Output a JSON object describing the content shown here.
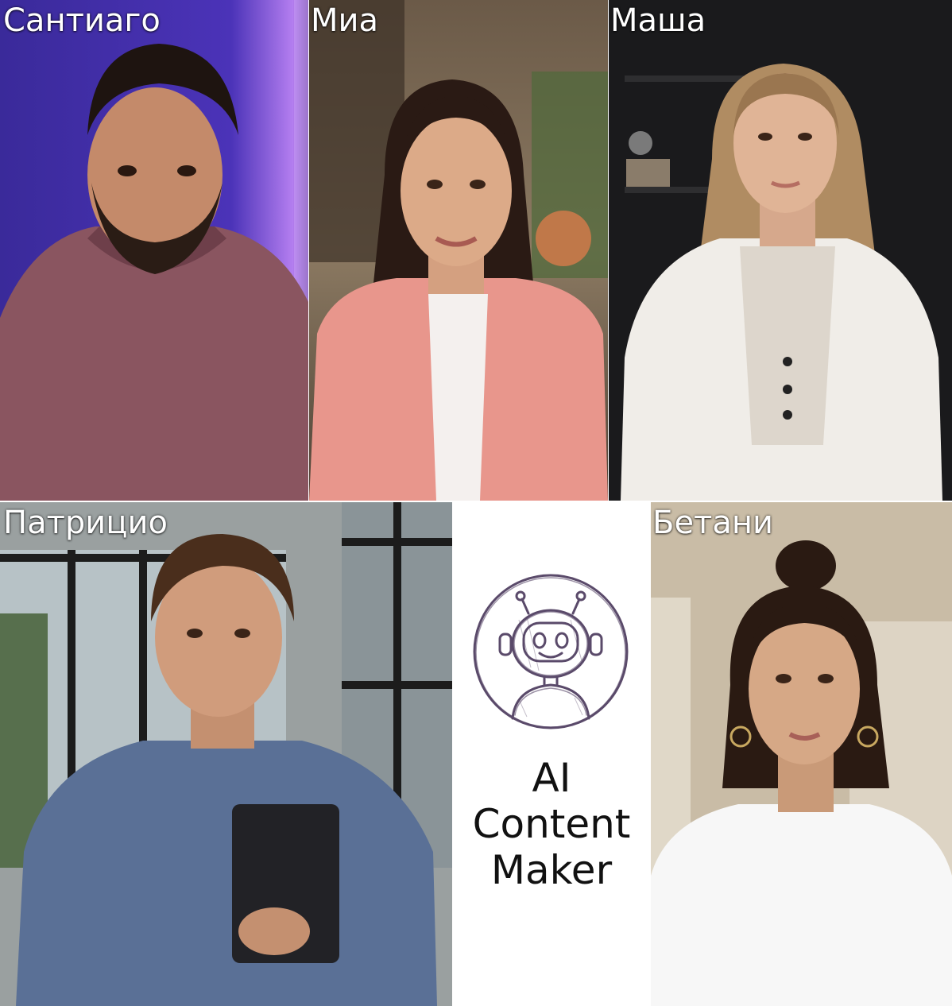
{
  "people": [
    {
      "id": "santiago",
      "name": "Сантиаго"
    },
    {
      "id": "mia",
      "name": "Миа"
    },
    {
      "id": "masha",
      "name": "Маша"
    },
    {
      "id": "patricio",
      "name": "Патрицио"
    },
    {
      "id": "bethany",
      "name": "Бетани"
    }
  ],
  "logo": {
    "icon": "robot-head-icon",
    "lines": [
      "AI",
      "Content",
      "Maker"
    ],
    "stroke_color": "#5a4a6a"
  }
}
